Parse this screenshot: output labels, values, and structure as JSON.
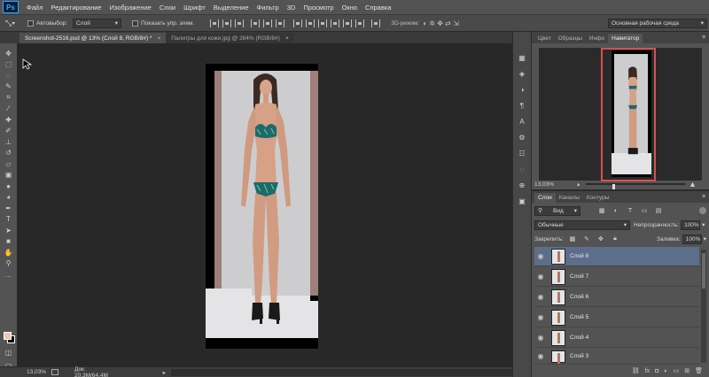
{
  "app": {
    "logo": "Ps"
  },
  "menu": [
    "Файл",
    "Редактирование",
    "Изображение",
    "Слои",
    "Шрифт",
    "Выделение",
    "Фильтр",
    "3D",
    "Просмотр",
    "Окно",
    "Справка"
  ],
  "options": {
    "autoselect_label": "Автовыбор:",
    "autoselect_value": "Слой",
    "show_controls_label": "Показать упр. элем.",
    "mode_3d_label": "3D-режим:",
    "workspace": "Основная рабочая среда"
  },
  "tabs": [
    {
      "label": "Screenshot-2516.psd @ 13% (Слой 8, RGB/8#) *",
      "active": true
    },
    {
      "label": "Палитры для кожи.jpg @ 264% (RGB/8#)",
      "active": false
    }
  ],
  "status": {
    "zoom": "13,03%",
    "doc_info": "Док: 20,3M/64,4M"
  },
  "navigator_panel": {
    "tabs": [
      "Цвет",
      "Образцы",
      "Инфо",
      "Навигатор"
    ],
    "active_tab": "Навигатор",
    "zoom": "13,03%"
  },
  "layers_panel": {
    "tabs": [
      "Слои",
      "Каналы",
      "Контуры"
    ],
    "active_tab": "Слои",
    "filter_label": "Вид",
    "blend_mode": "Обычные",
    "opacity_label": "Непрозрачность:",
    "opacity_value": "100%",
    "lock_label": "Закрепить:",
    "fill_label": "Заливка:",
    "fill_value": "100%",
    "layers": [
      {
        "name": "Слой 8",
        "selected": true
      },
      {
        "name": "Слой 7",
        "selected": false
      },
      {
        "name": "Слой 6",
        "selected": false
      },
      {
        "name": "Слой 5",
        "selected": false
      },
      {
        "name": "Слой 4",
        "selected": false
      },
      {
        "name": "Слой 3",
        "selected": false
      }
    ]
  },
  "colors": {
    "foreground": "#f3c3b4",
    "background": "#000000",
    "selection": "#5c6e8c",
    "navigator_frame": "#d75050"
  }
}
